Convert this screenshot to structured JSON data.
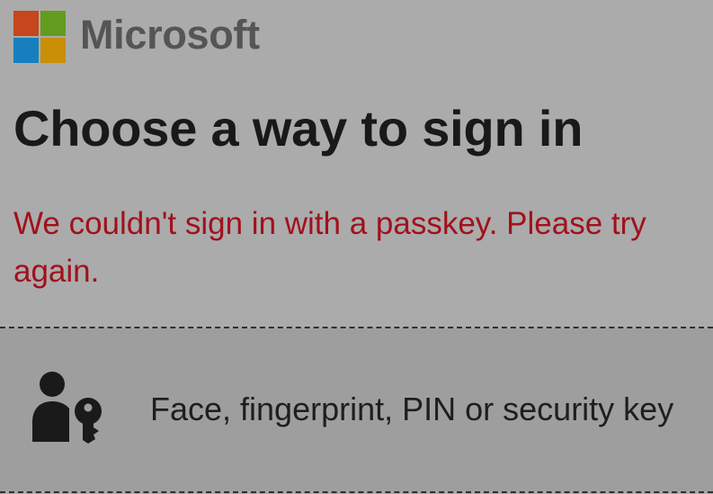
{
  "brand": {
    "name": "Microsoft",
    "logo_colors": [
      "#c6461e",
      "#639c1e",
      "#177fbd",
      "#c98f07"
    ]
  },
  "page": {
    "title": "Choose a way to sign in",
    "error_message": "We couldn't sign in with a passkey. Please try again."
  },
  "options": [
    {
      "label": "Face, fingerprint, PIN or security key",
      "icon": "user-key-icon"
    }
  ],
  "colors": {
    "error_text": "#a1111b",
    "background": "#ababab",
    "option_background": "#9e9e9e"
  }
}
